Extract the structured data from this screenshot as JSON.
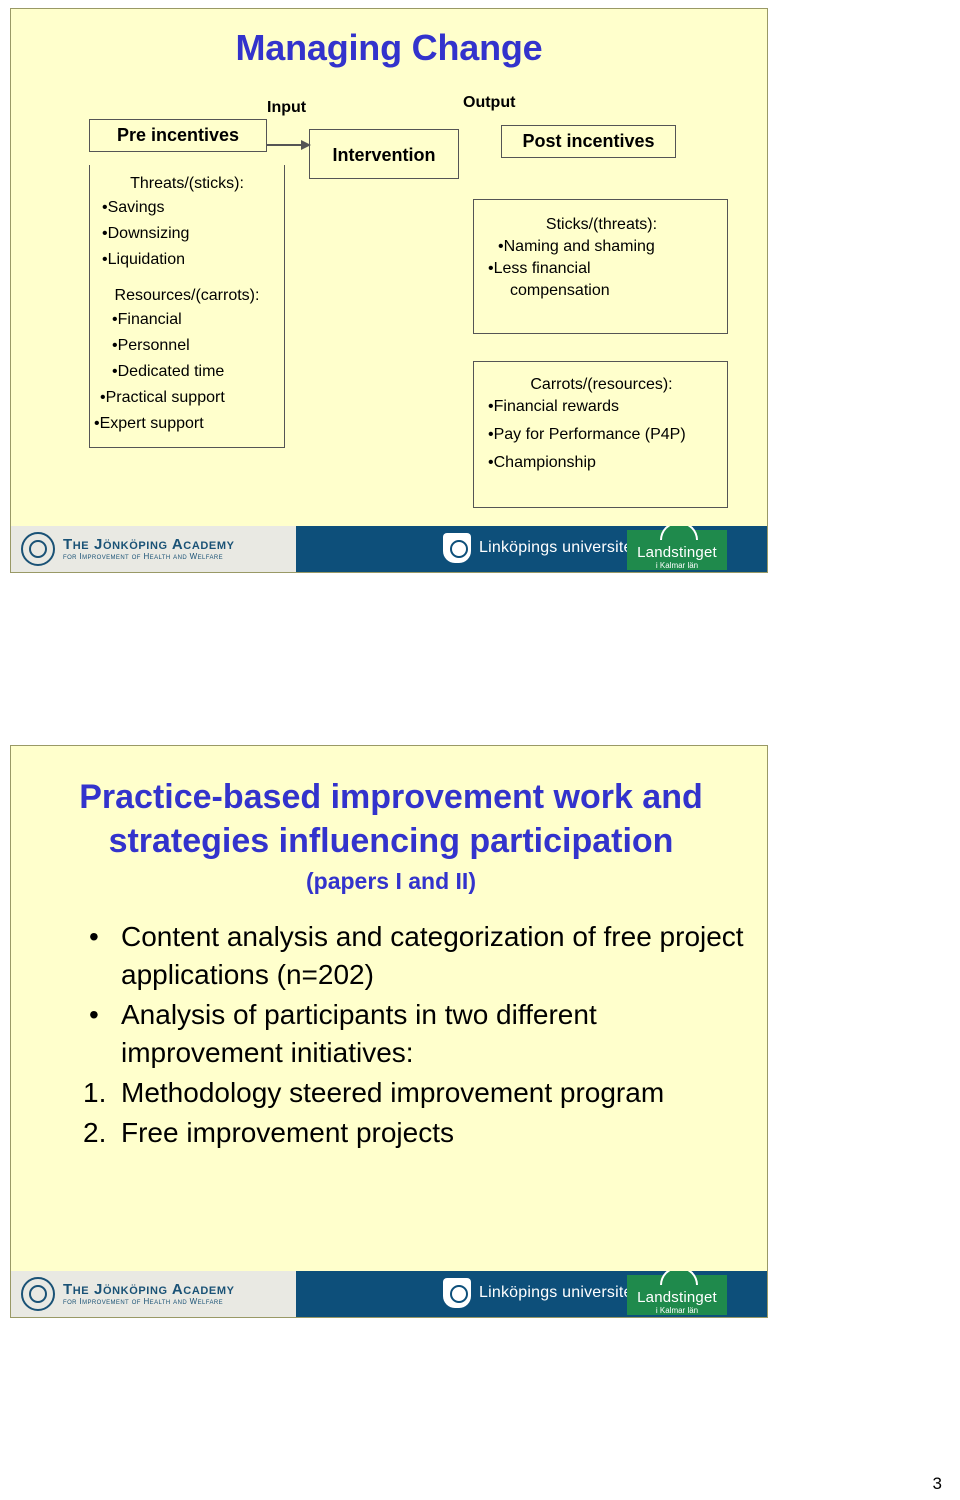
{
  "slide1": {
    "title": "Managing Change",
    "flow": {
      "input_label": "Input",
      "output_label": "Output",
      "pre_incentives": "Pre incentives",
      "intervention": "Intervention",
      "post_incentives": "Post incentives"
    },
    "left_column": {
      "group1_head": "Threats/(sticks):",
      "group1_items": [
        "Savings",
        "Downsizing",
        "Liquidation"
      ],
      "group2_head": "Resources/(carrots):",
      "group2_items": [
        "Financial",
        "Personnel",
        "Dedicated time",
        "Practical support",
        "Expert support"
      ]
    },
    "sticks_box": {
      "head": "Sticks/(threats):",
      "items": [
        "Naming and shaming",
        "Less financial",
        "compensation"
      ]
    },
    "carrots_box": {
      "head": "Carrots/(resources):",
      "items": [
        "Financial rewards",
        "Pay for Performance (P4P)",
        "Championship"
      ]
    }
  },
  "slide2": {
    "title_line1": "Practice-based improvement work and",
    "title_line2": "strategies influencing participation",
    "subtitle": "(papers I and II)",
    "bullets": [
      "Content analysis and categorization of free project applications (n=202)",
      "Analysis of participants in two different improvement initiatives:"
    ],
    "numbered": [
      {
        "marker": "1.",
        "text": "Methodology steered improvement  program"
      },
      {
        "marker": "2.",
        "text": "Free improvement projects"
      }
    ],
    "bullet_marker": "•"
  },
  "footer": {
    "academy_main": "The Jönköping Academy",
    "academy_sub": "for Improvement of Health and Welfare",
    "university": "Linköpings universitet",
    "county_main": "Landstinget",
    "county_sub": "i Kalmar län"
  },
  "page_number": "3",
  "colors": {
    "slide_bg": "#ffffcc",
    "heading": "#3333cc",
    "band": "#0d4f7a",
    "county_green": "#1f8a4c"
  }
}
